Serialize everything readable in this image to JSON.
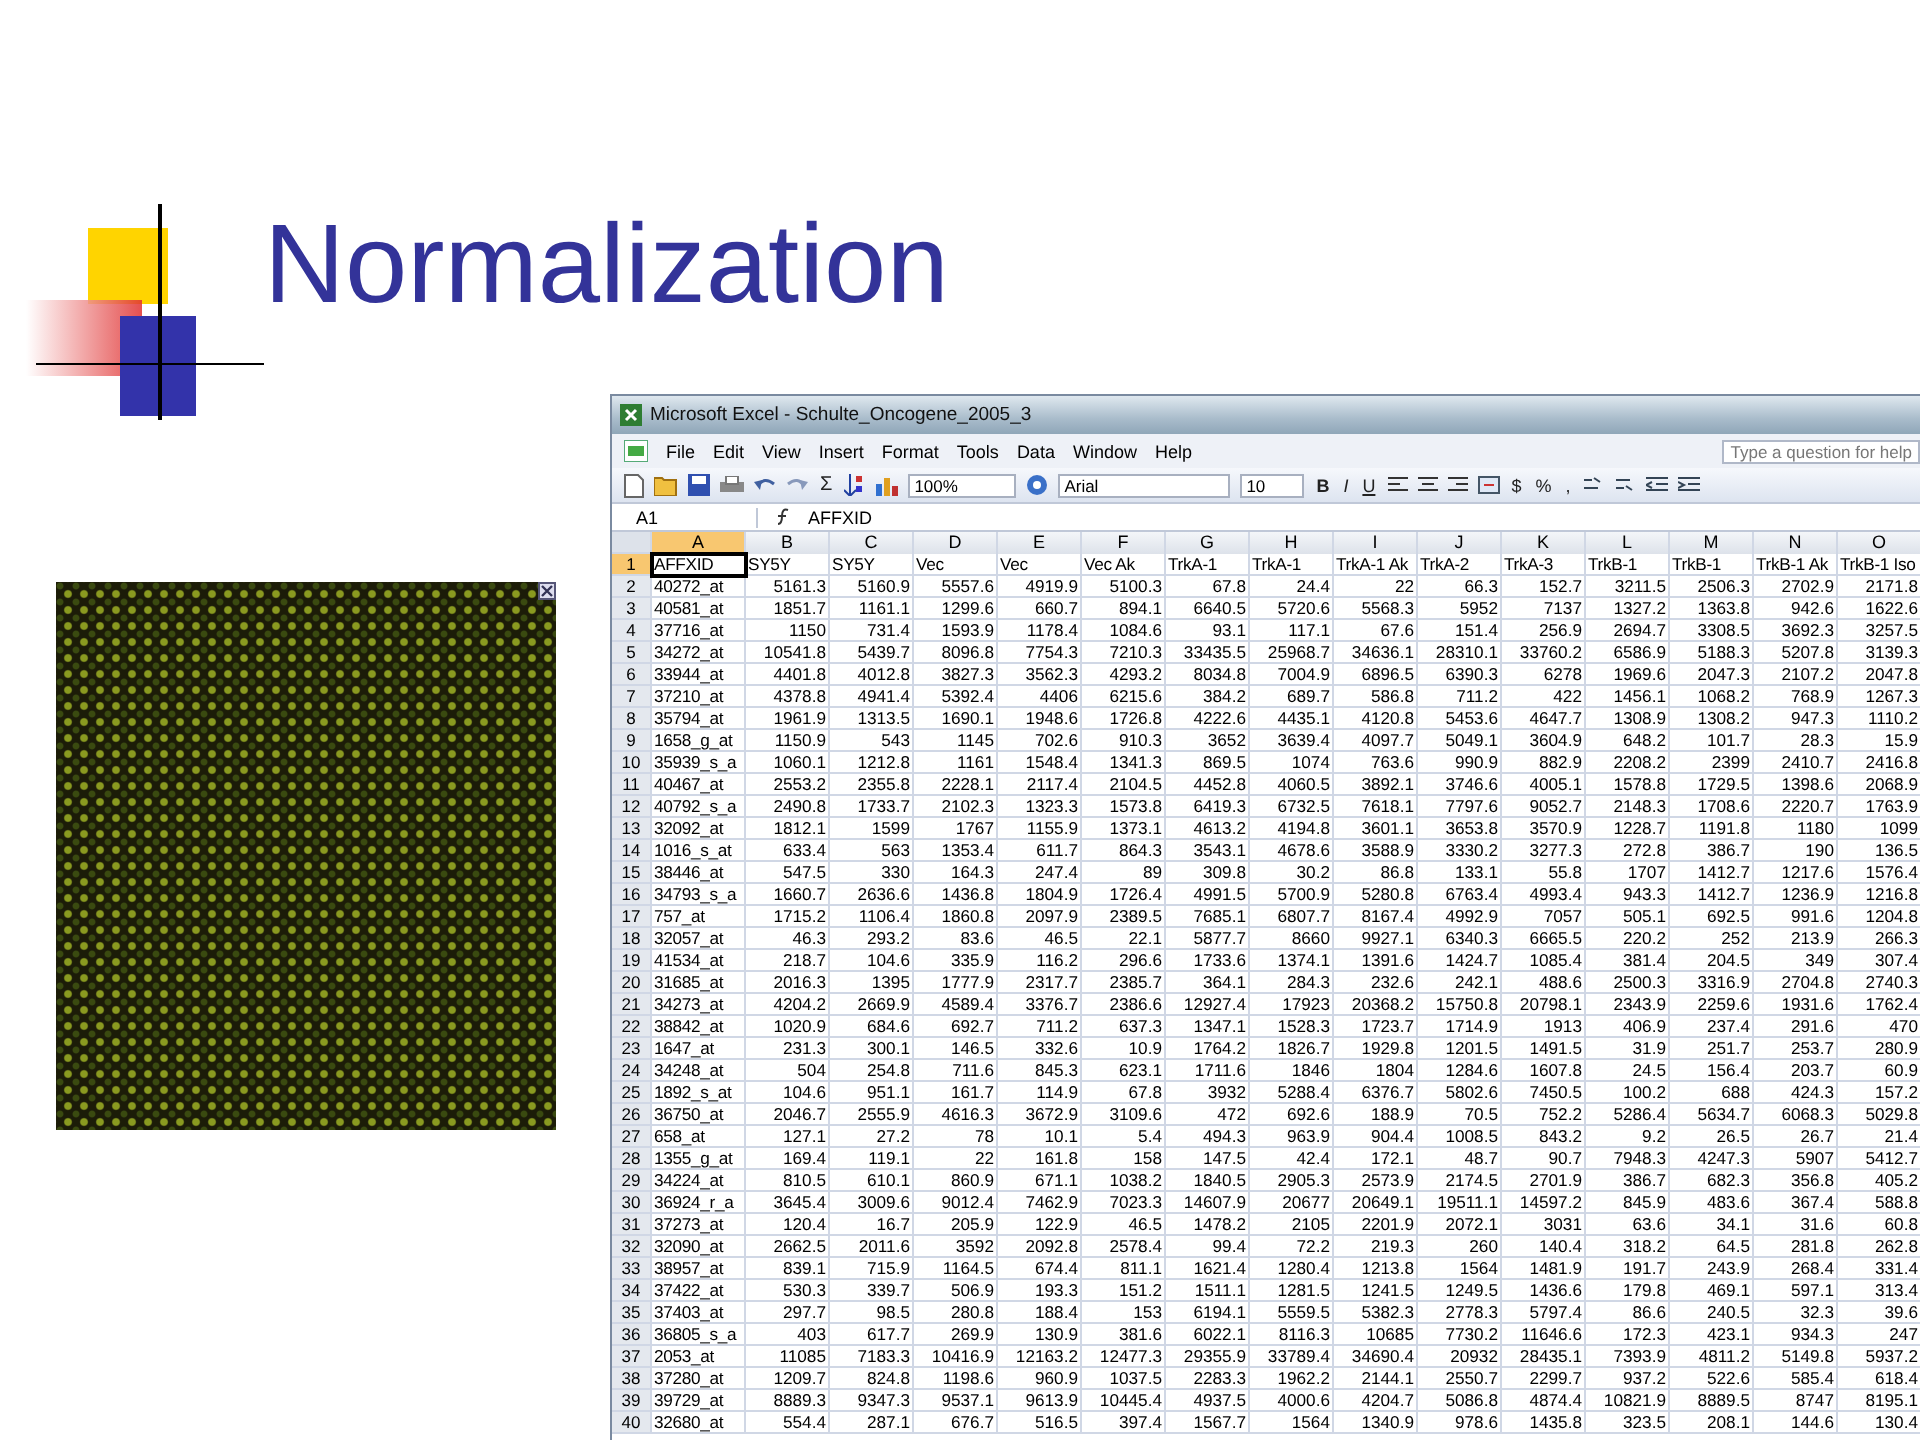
{
  "slide": {
    "title": "Normalization"
  },
  "excel": {
    "title": "Microsoft Excel - Schulte_Oncogene_2005_3",
    "menu": [
      "File",
      "Edit",
      "View",
      "Insert",
      "Format",
      "Tools",
      "Data",
      "Window",
      "Help"
    ],
    "help_placeholder": "Type a question for help",
    "sum_symbol": "Σ",
    "zoom": "100%",
    "font": "Arial",
    "font_size": "10",
    "format_buttons": [
      "B",
      "I",
      "U"
    ],
    "number_buttons": [
      "$",
      "%",
      ","
    ],
    "cell_ref": "A1",
    "formula": "AFFXID",
    "columns": [
      {
        "label": "A",
        "selected": true
      },
      {
        "label": "B",
        "selected": false
      },
      {
        "label": "C",
        "selected": false
      },
      {
        "label": "D",
        "selected": false
      },
      {
        "label": "E",
        "selected": false
      },
      {
        "label": "F",
        "selected": false
      },
      {
        "label": "G",
        "selected": false
      },
      {
        "label": "H",
        "selected": false
      },
      {
        "label": "I",
        "selected": false
      },
      {
        "label": "J",
        "selected": false
      },
      {
        "label": "K",
        "selected": false
      },
      {
        "label": "L",
        "selected": false
      },
      {
        "label": "M",
        "selected": false
      },
      {
        "label": "N",
        "selected": false
      },
      {
        "label": "O",
        "selected": false
      }
    ],
    "header_row": {
      "number": "1",
      "selected": true,
      "cells": [
        "AFFXID",
        "SY5Y",
        "SY5Y",
        "Vec",
        "Vec",
        "Vec Ak",
        "TrkA-1",
        "TrkA-1",
        "TrkA-1 Ak",
        "TrkA-2",
        "TrkA-3",
        "TrkB-1",
        "TrkB-1",
        "TrkB-1 Ak",
        "TrkB-1 Iso"
      ]
    },
    "rows": [
      {
        "number": "2",
        "selected": false,
        "cells": [
          "40272_at",
          "5161.3",
          "5160.9",
          "5557.6",
          "4919.9",
          "5100.3",
          "67.8",
          "24.4",
          "22",
          "66.3",
          "152.7",
          "3211.5",
          "2506.3",
          "2702.9",
          "2171.8"
        ]
      },
      {
        "number": "3",
        "selected": false,
        "cells": [
          "40581_at",
          "1851.7",
          "1161.1",
          "1299.6",
          "660.7",
          "894.1",
          "6640.5",
          "5720.6",
          "5568.3",
          "5952",
          "7137",
          "1327.2",
          "1363.8",
          "942.6",
          "1622.6"
        ]
      },
      {
        "number": "4",
        "selected": false,
        "cells": [
          "37716_at",
          "1150",
          "731.4",
          "1593.9",
          "1178.4",
          "1084.6",
          "93.1",
          "117.1",
          "67.6",
          "151.4",
          "256.9",
          "2694.7",
          "3308.5",
          "3692.3",
          "3257.5"
        ]
      },
      {
        "number": "5",
        "selected": false,
        "cells": [
          "34272_at",
          "10541.8",
          "5439.7",
          "8096.8",
          "7754.3",
          "7210.3",
          "33435.5",
          "25968.7",
          "34636.1",
          "28310.1",
          "33760.2",
          "6586.9",
          "5188.3",
          "5207.8",
          "3139.3"
        ]
      },
      {
        "number": "6",
        "selected": false,
        "cells": [
          "33944_at",
          "4401.8",
          "4012.8",
          "3827.3",
          "3562.3",
          "4293.2",
          "8034.8",
          "7004.9",
          "6896.5",
          "6390.3",
          "6278",
          "1969.6",
          "2047.3",
          "2107.2",
          "2047.8"
        ]
      },
      {
        "number": "7",
        "selected": false,
        "cells": [
          "37210_at",
          "4378.8",
          "4941.4",
          "5392.4",
          "4406",
          "6215.6",
          "384.2",
          "689.7",
          "586.8",
          "711.2",
          "422",
          "1456.1",
          "1068.2",
          "768.9",
          "1267.3"
        ]
      },
      {
        "number": "8",
        "selected": false,
        "cells": [
          "35794_at",
          "1961.9",
          "1313.5",
          "1690.1",
          "1948.6",
          "1726.8",
          "4222.6",
          "4435.1",
          "4120.8",
          "5453.6",
          "4647.7",
          "1308.9",
          "1308.2",
          "947.3",
          "1110.2"
        ]
      },
      {
        "number": "9",
        "selected": false,
        "cells": [
          "1658_g_at",
          "1150.9",
          "543",
          "1145",
          "702.6",
          "910.3",
          "3652",
          "3639.4",
          "4097.7",
          "5049.1",
          "3604.9",
          "648.2",
          "101.7",
          "28.3",
          "15.9"
        ]
      },
      {
        "number": "10",
        "selected": false,
        "cells": [
          "35939_s_a",
          "1060.1",
          "1212.8",
          "1161",
          "1548.4",
          "1341.3",
          "869.5",
          "1074",
          "763.6",
          "990.9",
          "882.9",
          "2208.2",
          "2399",
          "2410.7",
          "2416.8"
        ]
      },
      {
        "number": "11",
        "selected": false,
        "cells": [
          "40467_at",
          "2553.2",
          "2355.8",
          "2228.1",
          "2117.4",
          "2104.5",
          "4452.8",
          "4060.5",
          "3892.1",
          "3746.6",
          "4005.1",
          "1578.8",
          "1729.5",
          "1398.6",
          "2068.9"
        ]
      },
      {
        "number": "12",
        "selected": false,
        "cells": [
          "40792_s_a",
          "2490.8",
          "1733.7",
          "2102.3",
          "1323.3",
          "1573.8",
          "6419.3",
          "6732.5",
          "7618.1",
          "7797.6",
          "9052.7",
          "2148.3",
          "1708.6",
          "2220.7",
          "1763.9"
        ]
      },
      {
        "number": "13",
        "selected": false,
        "cells": [
          "32092_at",
          "1812.1",
          "1599",
          "1767",
          "1155.9",
          "1373.1",
          "4613.2",
          "4194.8",
          "3601.1",
          "3653.8",
          "3570.9",
          "1228.7",
          "1191.8",
          "1180",
          "1099"
        ]
      },
      {
        "number": "14",
        "selected": false,
        "cells": [
          "1016_s_at",
          "633.4",
          "563",
          "1353.4",
          "611.7",
          "864.3",
          "3543.1",
          "4678.6",
          "3588.9",
          "3330.2",
          "3277.3",
          "272.8",
          "386.7",
          "190",
          "136.5"
        ]
      },
      {
        "number": "15",
        "selected": false,
        "cells": [
          "38446_at",
          "547.5",
          "330",
          "164.3",
          "247.4",
          "89",
          "309.8",
          "30.2",
          "86.8",
          "133.1",
          "55.8",
          "1707",
          "1412.7",
          "1217.6",
          "1576.4"
        ]
      },
      {
        "number": "16",
        "selected": false,
        "cells": [
          "34793_s_a",
          "1660.7",
          "2636.6",
          "1436.8",
          "1804.9",
          "1726.4",
          "4991.5",
          "5700.9",
          "5280.8",
          "6763.4",
          "4993.4",
          "943.3",
          "1412.7",
          "1236.9",
          "1216.8"
        ]
      },
      {
        "number": "17",
        "selected": false,
        "cells": [
          "757_at",
          "1715.2",
          "1106.4",
          "1860.8",
          "2097.9",
          "2389.5",
          "7685.1",
          "6807.7",
          "8167.4",
          "4992.9",
          "7057",
          "505.1",
          "692.5",
          "991.6",
          "1204.8"
        ]
      },
      {
        "number": "18",
        "selected": false,
        "cells": [
          "32057_at",
          "46.3",
          "293.2",
          "83.6",
          "46.5",
          "22.1",
          "5877.7",
          "8660",
          "9927.1",
          "6340.3",
          "6665.5",
          "220.2",
          "252",
          "213.9",
          "266.3"
        ]
      },
      {
        "number": "19",
        "selected": false,
        "cells": [
          "41534_at",
          "218.7",
          "104.6",
          "335.9",
          "116.2",
          "296.6",
          "1733.6",
          "1374.1",
          "1391.6",
          "1424.7",
          "1085.4",
          "381.4",
          "204.5",
          "349",
          "307.4"
        ]
      },
      {
        "number": "20",
        "selected": false,
        "cells": [
          "31685_at",
          "2016.3",
          "1395",
          "1777.9",
          "2317.7",
          "2385.7",
          "364.1",
          "284.3",
          "232.6",
          "242.1",
          "488.6",
          "2500.3",
          "3316.9",
          "2704.8",
          "2740.3"
        ]
      },
      {
        "number": "21",
        "selected": false,
        "cells": [
          "34273_at",
          "4204.2",
          "2669.9",
          "4589.4",
          "3376.7",
          "2386.6",
          "12927.4",
          "17923",
          "20368.2",
          "15750.8",
          "20798.1",
          "2343.9",
          "2259.6",
          "1931.6",
          "1762.4"
        ]
      },
      {
        "number": "22",
        "selected": false,
        "cells": [
          "38842_at",
          "1020.9",
          "684.6",
          "692.7",
          "711.2",
          "637.3",
          "1347.1",
          "1528.3",
          "1723.7",
          "1714.9",
          "1913",
          "406.9",
          "237.4",
          "291.6",
          "470"
        ]
      },
      {
        "number": "23",
        "selected": false,
        "cells": [
          "1647_at",
          "231.3",
          "300.1",
          "146.5",
          "332.6",
          "10.9",
          "1764.2",
          "1826.7",
          "1929.8",
          "1201.5",
          "1491.5",
          "31.9",
          "251.7",
          "253.7",
          "280.9"
        ]
      },
      {
        "number": "24",
        "selected": false,
        "cells": [
          "34248_at",
          "504",
          "254.8",
          "711.6",
          "845.3",
          "623.1",
          "1711.6",
          "1846",
          "1804",
          "1284.6",
          "1607.8",
          "24.5",
          "156.4",
          "203.7",
          "60.9"
        ]
      },
      {
        "number": "25",
        "selected": false,
        "cells": [
          "1892_s_at",
          "104.6",
          "951.1",
          "161.7",
          "114.9",
          "67.8",
          "3932",
          "5288.4",
          "6376.7",
          "5802.6",
          "7450.5",
          "100.2",
          "688",
          "424.3",
          "157.2"
        ]
      },
      {
        "number": "26",
        "selected": false,
        "cells": [
          "36750_at",
          "2046.7",
          "2555.9",
          "4616.3",
          "3672.9",
          "3109.6",
          "472",
          "692.6",
          "188.9",
          "70.5",
          "752.2",
          "5286.4",
          "5634.7",
          "6068.3",
          "5029.8"
        ]
      },
      {
        "number": "27",
        "selected": false,
        "cells": [
          "658_at",
          "127.1",
          "27.2",
          "78",
          "10.1",
          "5.4",
          "494.3",
          "963.9",
          "904.4",
          "1008.5",
          "843.2",
          "9.2",
          "26.5",
          "26.7",
          "21.4"
        ]
      },
      {
        "number": "28",
        "selected": false,
        "cells": [
          "1355_g_at",
          "169.4",
          "119.1",
          "22",
          "161.8",
          "158",
          "147.5",
          "42.4",
          "172.1",
          "48.7",
          "90.7",
          "7948.3",
          "4247.3",
          "5907",
          "5412.7"
        ]
      },
      {
        "number": "29",
        "selected": false,
        "cells": [
          "34224_at",
          "810.5",
          "610.1",
          "860.9",
          "671.1",
          "1038.2",
          "1840.5",
          "2905.3",
          "2573.9",
          "2174.5",
          "2701.9",
          "386.7",
          "682.3",
          "356.8",
          "405.2"
        ]
      },
      {
        "number": "30",
        "selected": false,
        "cells": [
          "36924_r_a",
          "3645.4",
          "3009.6",
          "9012.4",
          "7462.9",
          "7023.3",
          "14607.9",
          "20677",
          "20649.1",
          "19511.1",
          "14597.2",
          "845.9",
          "483.6",
          "367.4",
          "588.8"
        ]
      },
      {
        "number": "31",
        "selected": false,
        "cells": [
          "37273_at",
          "120.4",
          "16.7",
          "205.9",
          "122.9",
          "46.5",
          "1478.2",
          "2105",
          "2201.9",
          "2072.1",
          "3031",
          "63.6",
          "34.1",
          "31.6",
          "60.8"
        ]
      },
      {
        "number": "32",
        "selected": false,
        "cells": [
          "32090_at",
          "2662.5",
          "2011.6",
          "3592",
          "2092.8",
          "2578.4",
          "99.4",
          "72.2",
          "219.3",
          "260",
          "140.4",
          "318.2",
          "64.5",
          "281.8",
          "262.8"
        ]
      },
      {
        "number": "33",
        "selected": false,
        "cells": [
          "38957_at",
          "839.1",
          "715.9",
          "1164.5",
          "674.4",
          "811.1",
          "1621.4",
          "1280.4",
          "1213.8",
          "1564",
          "1481.9",
          "191.7",
          "243.9",
          "268.4",
          "331.4"
        ]
      },
      {
        "number": "34",
        "selected": false,
        "cells": [
          "37422_at",
          "530.3",
          "339.7",
          "506.9",
          "193.3",
          "151.2",
          "1511.1",
          "1281.5",
          "1241.5",
          "1249.5",
          "1436.6",
          "179.8",
          "469.1",
          "597.1",
          "313.4"
        ]
      },
      {
        "number": "35",
        "selected": false,
        "cells": [
          "37403_at",
          "297.7",
          "98.5",
          "280.8",
          "188.4",
          "153",
          "6194.1",
          "5559.5",
          "5382.3",
          "2778.3",
          "5797.4",
          "86.6",
          "240.5",
          "32.3",
          "39.6"
        ]
      },
      {
        "number": "36",
        "selected": false,
        "cells": [
          "36805_s_a",
          "403",
          "617.7",
          "269.9",
          "130.9",
          "381.6",
          "6022.1",
          "8116.3",
          "10685",
          "7730.2",
          "11646.6",
          "172.3",
          "423.1",
          "934.3",
          "247"
        ]
      },
      {
        "number": "37",
        "selected": false,
        "cells": [
          "2053_at",
          "11085",
          "7183.3",
          "10416.9",
          "12163.2",
          "12477.3",
          "29355.9",
          "33789.4",
          "34690.4",
          "20932",
          "28435.1",
          "7393.9",
          "4811.2",
          "5149.8",
          "5937.2"
        ]
      },
      {
        "number": "38",
        "selected": false,
        "cells": [
          "37280_at",
          "1209.7",
          "824.8",
          "1198.6",
          "960.9",
          "1037.5",
          "2283.3",
          "1962.2",
          "2144.1",
          "2550.7",
          "2299.7",
          "937.2",
          "522.6",
          "585.4",
          "618.4"
        ]
      },
      {
        "number": "39",
        "selected": false,
        "cells": [
          "39729_at",
          "8889.3",
          "9347.3",
          "9537.1",
          "9613.9",
          "10445.4",
          "4937.5",
          "4000.6",
          "4204.7",
          "5086.8",
          "4874.4",
          "10821.9",
          "8889.5",
          "8747",
          "8195.1"
        ]
      },
      {
        "number": "40",
        "selected": false,
        "cells": [
          "32680_at",
          "554.4",
          "287.1",
          "676.7",
          "516.5",
          "397.4",
          "1567.7",
          "1564",
          "1340.9",
          "978.6",
          "1435.8",
          "323.5",
          "208.1",
          "144.6",
          "130.4"
        ]
      }
    ]
  }
}
